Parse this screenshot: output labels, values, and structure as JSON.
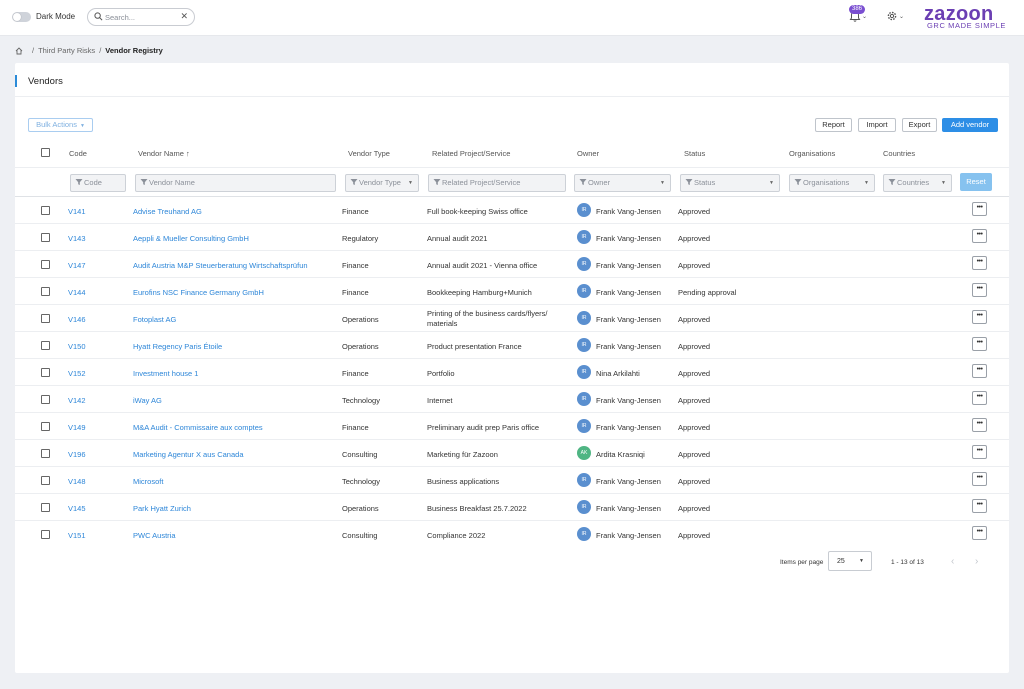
{
  "topbar": {
    "dark_mode_label": "Dark Mode",
    "search_placeholder": "Search...",
    "notifications_count": "386",
    "logo": "zazoon",
    "tagline": "GRC MADE SIMPLE"
  },
  "breadcrumb": {
    "parent": "Third Party Risks",
    "current": "Vendor Registry"
  },
  "card": {
    "title": "Vendors",
    "bulk_actions": "Bulk Actions",
    "report": "Report",
    "import": "Import",
    "export": "Export",
    "add_vendor": "Add vendor"
  },
  "table": {
    "headers": {
      "code": "Code",
      "vendor_name": "Vendor Name",
      "sort_indicator": "↑",
      "vendor_type": "Vendor Type",
      "related": "Related Project/Service",
      "owner": "Owner",
      "status": "Status",
      "organisations": "Organisations",
      "countries": "Countries"
    },
    "filters": {
      "code": "Code",
      "vendor_name": "Vendor Name",
      "vendor_type": "Vendor Type",
      "related": "Related Project/Service",
      "owner": "Owner",
      "status": "Status",
      "organisations": "Organisations",
      "countries": "Countries",
      "reset": "Reset"
    },
    "rows": [
      {
        "code": "V141",
        "name": "Advise Treuhand AG",
        "type": "Finance",
        "related": "Full book-keeping Swiss office",
        "owner_initials": "IR",
        "owner": "Frank Vang-Jensen",
        "status": "Approved"
      },
      {
        "code": "V143",
        "name": "Aeppli & Mueller Consulting GmbH",
        "type": "Regulatory",
        "related": "Annual audit 2021",
        "owner_initials": "IR",
        "owner": "Frank Vang-Jensen",
        "status": "Approved"
      },
      {
        "code": "V147",
        "name": "Audit Austria M&P Steuerberatung Wirtschaftsprüfun",
        "type": "Finance",
        "related": "Annual audit 2021 - Vienna office",
        "owner_initials": "IR",
        "owner": "Frank Vang-Jensen",
        "status": "Approved"
      },
      {
        "code": "V144",
        "name": "Eurofins NSC Finance Germany GmbH",
        "type": "Finance",
        "related": "Bookkeeping Hamburg+Munich",
        "owner_initials": "IR",
        "owner": "Frank Vang-Jensen",
        "status": "Pending approval"
      },
      {
        "code": "V146",
        "name": "Fotoplast AG",
        "type": "Operations",
        "related": "Printing of the business cards/flyers/ materials",
        "owner_initials": "IR",
        "owner": "Frank Vang-Jensen",
        "status": "Approved"
      },
      {
        "code": "V150",
        "name": "Hyatt Regency Paris Étoile",
        "type": "Operations",
        "related": "Product presentation France",
        "owner_initials": "IR",
        "owner": "Frank Vang-Jensen",
        "status": "Approved"
      },
      {
        "code": "V152",
        "name": "Investment house 1",
        "type": "Finance",
        "related": "Portfolio",
        "owner_initials": "IR",
        "owner": "Nina Arkilahti",
        "status": "Approved"
      },
      {
        "code": "V142",
        "name": "iWay AG",
        "type": "Technology",
        "related": "Internet",
        "owner_initials": "IR",
        "owner": "Frank Vang-Jensen",
        "status": "Approved"
      },
      {
        "code": "V149",
        "name": "M&A Audit - Commissaire aux comptes",
        "type": "Finance",
        "related": "Preliminary audit prep Paris office",
        "owner_initials": "IR",
        "owner": "Frank Vang-Jensen",
        "status": "Approved"
      },
      {
        "code": "V196",
        "name": "Marketing Agentur X aus Canada",
        "type": "Consulting",
        "related": "Marketing für Zazoon",
        "owner_initials": "AK",
        "owner": "Ardita Krasniqi",
        "status": "Approved"
      },
      {
        "code": "V148",
        "name": "Microsoft",
        "type": "Technology",
        "related": "Business applications",
        "owner_initials": "IR",
        "owner": "Frank Vang-Jensen",
        "status": "Approved"
      },
      {
        "code": "V145",
        "name": "Park Hyatt Zurich",
        "type": "Operations",
        "related": "Business Breakfast 25.7.2022",
        "owner_initials": "IR",
        "owner": "Frank Vang-Jensen",
        "status": "Approved"
      },
      {
        "code": "V151",
        "name": "PWC Austria",
        "type": "Consulting",
        "related": "Compliance 2022",
        "owner_initials": "IR",
        "owner": "Frank Vang-Jensen",
        "status": "Approved"
      }
    ]
  },
  "pagination": {
    "items_per_page_label": "Items per page",
    "items_per_page": "25",
    "range": "1 - 13 of 13"
  },
  "colors": {
    "accent": "#2d8ee6",
    "brand": "#6b3fb3",
    "link": "#2d86d8"
  }
}
